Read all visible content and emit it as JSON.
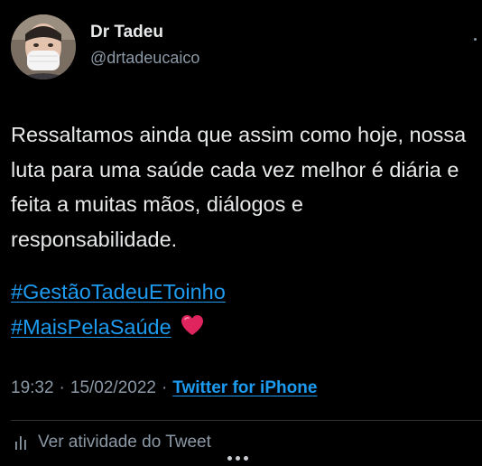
{
  "author": {
    "display_name": "Dr Tadeu",
    "handle": "@drtadeucaico"
  },
  "tweet": {
    "text": "Ressaltamos ainda que assim como hoje, nossa luta para uma saúde cada vez melhor é diária e feita a muitas mãos, diálogos e responsabilidade.",
    "hashtags": [
      "#GestãoTadeuEToinho",
      "#MaisPelaSaúde"
    ],
    "emoji": "red-heart-icon"
  },
  "meta": {
    "time": "19:32",
    "separator": "·",
    "date": "15/02/2022",
    "source": "Twitter for iPhone"
  },
  "footer": {
    "activity_label": "Ver atividade do Tweet"
  },
  "colors": {
    "background": "#000000",
    "text": "#e7e9ea",
    "secondary": "#8b98a5",
    "link": "#1d9bf0",
    "heart": "#e0245e"
  }
}
